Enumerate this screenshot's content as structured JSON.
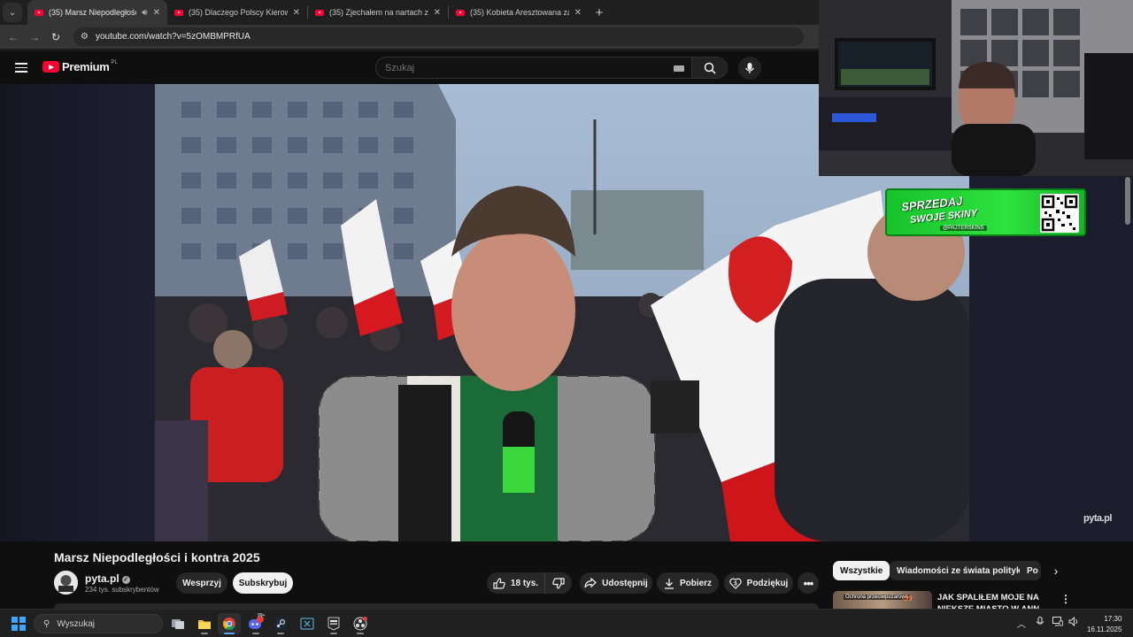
{
  "browser": {
    "tabs": [
      {
        "label": "(35) Marsz Niepodległości i",
        "active": true
      },
      {
        "label": "(35) Dlaczego Polscy Kierowcy",
        "active": false
      },
      {
        "label": "(35) Zjechałem na nartach z Mo",
        "active": false
      },
      {
        "label": "(35) Kobieta Aresztowana za Uj",
        "active": false
      }
    ],
    "new_tab": "+",
    "url": "youtube.com/watch?v=5zOMBMPRfUA"
  },
  "youtube": {
    "logo_text": "Premium",
    "country_code": "PL",
    "search_placeholder": "Szukaj"
  },
  "video": {
    "title": "Marsz Niepodległości i kontra 2025",
    "watermark": "pyta.pl",
    "channel": {
      "name": "pyta.pl",
      "subscribers": "234 tys. subskrybentów"
    },
    "buttons": {
      "support": "Wesprzyj",
      "subscribe": "Subskrybuj",
      "likes": "18 tys.",
      "share": "Udostępnij",
      "download": "Pobierz",
      "thanks": "Podziękuj"
    }
  },
  "overlay": {
    "promo_line1": "SPRZEDAJ",
    "promo_line2": "SWOJE SKINY",
    "promo_handle": "@PAJTERSKINS"
  },
  "sidebar": {
    "chips": [
      "Wszystkie",
      "Wiadomości ze świata polityki",
      "Po"
    ],
    "recommendation": {
      "title": "JAK SPALIŁEM MOJE NA NIEKSZE MIASTO W ANN",
      "thumb_tag": "Ochrona przeciwpożarowa",
      "thumb_number": "-39"
    }
  },
  "taskbar": {
    "search_placeholder": "Wyszukaj",
    "time": "17:30",
    "date": "16.11.2025",
    "notification_badge": "99+"
  },
  "colors": {
    "youtube_red": "#ff0033",
    "promo_green": "#2ee23f",
    "accent_blue": "#3ea6ff"
  }
}
